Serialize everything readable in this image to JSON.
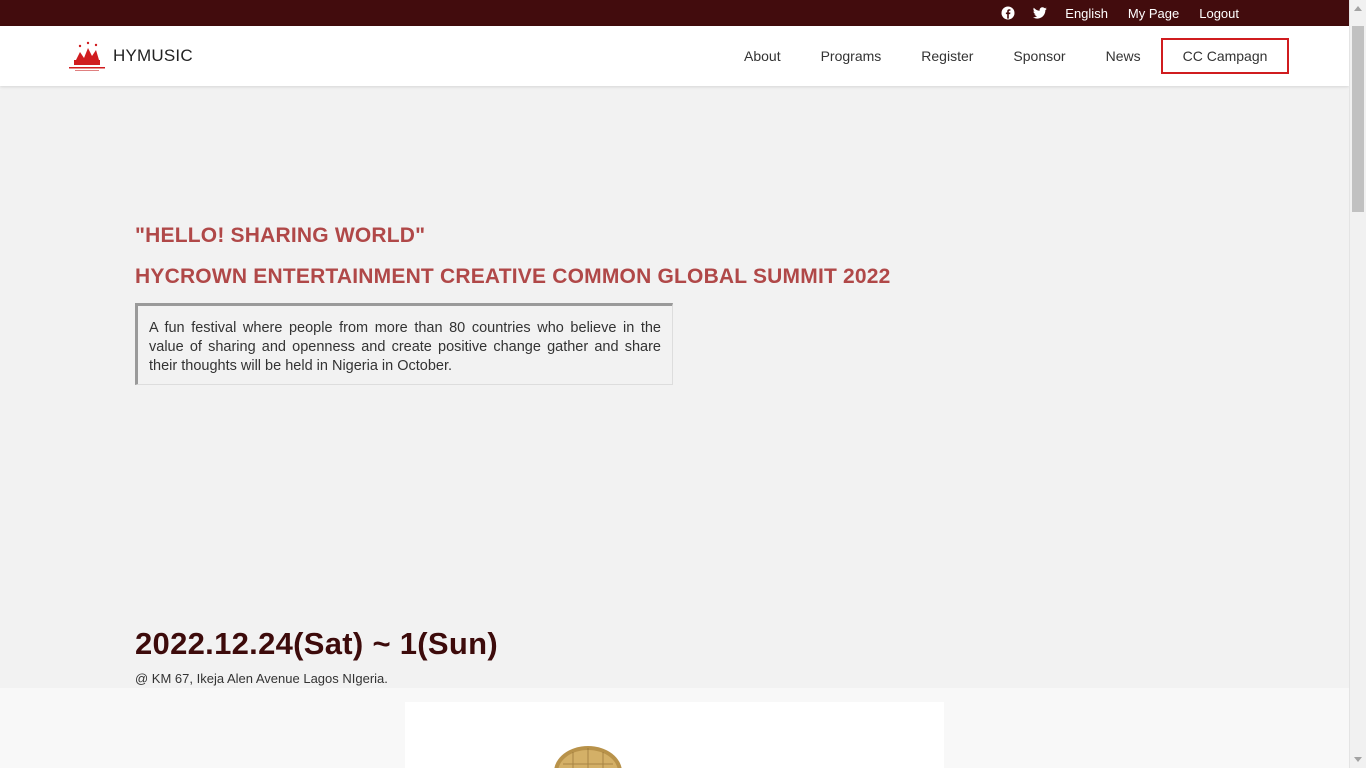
{
  "topbar": {
    "icons": [
      "facebook-icon",
      "twitter-icon"
    ],
    "links": [
      "English",
      "My Page",
      "Logout"
    ]
  },
  "navbar": {
    "brand": "HYMUSIC",
    "logo": "hycrown-logo",
    "menu": [
      "About",
      "Programs",
      "Register",
      "Sponsor",
      "News"
    ],
    "cta": "CC Campagn"
  },
  "hero": {
    "quote": "\"HELLO! SHARING WORLD\"",
    "title": "HYCROWN ENTERTAINMENT CREATIVE COMMON GLOBAL SUMMIT 2022",
    "description": "A fun festival where people from more than 80 countries who believe in the value of sharing and openness and create positive change gather and share their thoughts will be held in Nigeria in October."
  },
  "event": {
    "date": "2022.12.24(Sat) ~ 1(Sun)",
    "location": "@ KM 67, Ikeja Alen Avenue Lagos NIgeria."
  },
  "colors": {
    "topbar_bg": "#420c0d",
    "accent_red": "#d01c1f",
    "hero_text": "#b04848",
    "date_text": "#3d0b0b"
  }
}
